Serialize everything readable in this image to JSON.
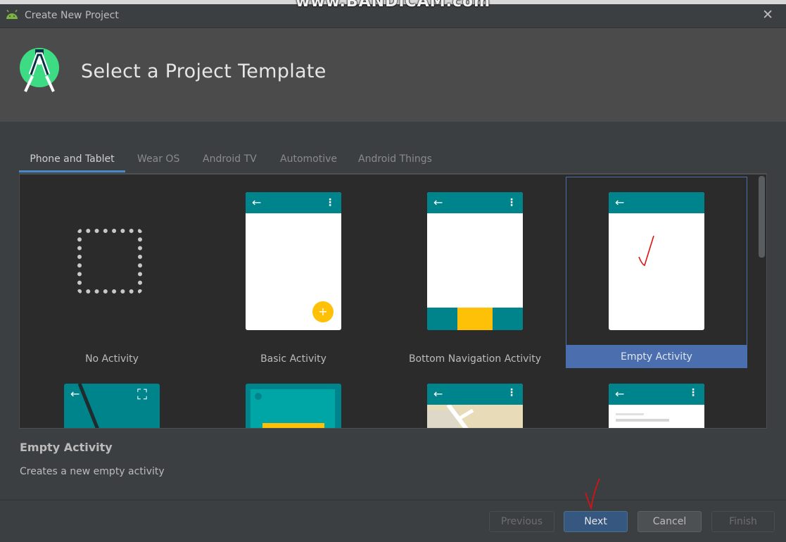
{
  "recorder_watermark": "www.BANDICAM.com",
  "window": {
    "title": "Create New Project",
    "close_symbol": "✕"
  },
  "header": {
    "title": "Select a Project Template"
  },
  "tabs": [
    {
      "label": "Phone and Tablet",
      "active": true
    },
    {
      "label": "Wear OS",
      "active": false
    },
    {
      "label": "Android TV",
      "active": false
    },
    {
      "label": "Automotive",
      "active": false
    },
    {
      "label": "Android Things",
      "active": false
    }
  ],
  "templates": [
    {
      "label": "No Activity"
    },
    {
      "label": "Basic Activity"
    },
    {
      "label": "Bottom Navigation Activity"
    },
    {
      "label": "Empty Activity",
      "selected": true
    }
  ],
  "phone_icons": {
    "back": "←",
    "more": "⋮",
    "fab": "+",
    "fullscreen": "⛶"
  },
  "description": {
    "title": "Empty Activity",
    "text": "Creates a new empty activity"
  },
  "buttons": {
    "previous": "Previous",
    "next": "Next",
    "cancel": "Cancel",
    "finish": "Finish"
  },
  "colors": {
    "accent_blue": "#4b6eaf",
    "phone_appbar": "#00848c",
    "fab_yellow": "#ffc107",
    "annotation_red": "#e01010"
  }
}
